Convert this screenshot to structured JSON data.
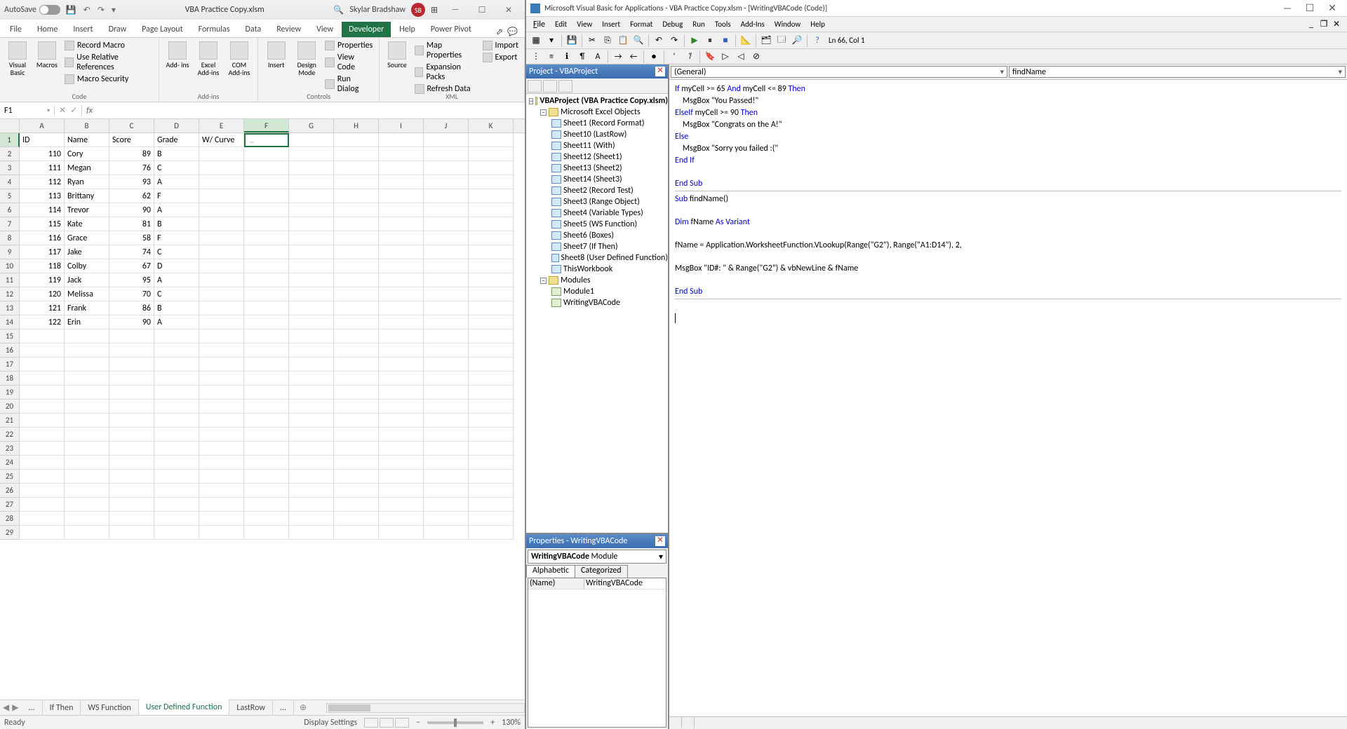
{
  "excel": {
    "autosave": "AutoSave",
    "title": "VBA Practice Copy.xlsm",
    "user_name": "Skylar Bradshaw",
    "user_initials": "SB",
    "tabs": [
      "File",
      "Home",
      "Insert",
      "Draw",
      "Page Layout",
      "Formulas",
      "Data",
      "Review",
      "View",
      "Developer",
      "Help",
      "Power Pivot"
    ],
    "active_tab": "Developer",
    "ribbon": {
      "code": {
        "label": "Code",
        "vb": "Visual\nBasic",
        "macros": "Macros",
        "record": "Record Macro",
        "relref": "Use Relative References",
        "security": "Macro Security"
      },
      "addins": {
        "label": "Add-ins",
        "addins": "Add-\nins",
        "excel_addins": "Excel\nAdd-ins",
        "com_addins": "COM\nAdd-ins"
      },
      "controls": {
        "label": "Controls",
        "insert": "Insert",
        "design": "Design\nMode",
        "props": "Properties",
        "viewcode": "View Code",
        "rundialog": "Run Dialog"
      },
      "xml": {
        "label": "XML",
        "source": "Source",
        "mapprops": "Map Properties",
        "expansion": "Expansion Packs",
        "refresh": "Refresh Data",
        "import": "Import",
        "export": "Export"
      }
    },
    "name_box": "F1",
    "columns": [
      "A",
      "B",
      "C",
      "D",
      "E",
      "F",
      "G",
      "H",
      "I",
      "J",
      "K"
    ],
    "headers": [
      "ID",
      "Name",
      "Score",
      "Grade",
      "W/ Curve"
    ],
    "rows": [
      {
        "id": "110",
        "name": "Cory",
        "score": "89",
        "grade": "B"
      },
      {
        "id": "111",
        "name": "Megan",
        "score": "76",
        "grade": "C"
      },
      {
        "id": "112",
        "name": "Ryan",
        "score": "93",
        "grade": "A"
      },
      {
        "id": "113",
        "name": "Brittany",
        "score": "62",
        "grade": "F"
      },
      {
        "id": "114",
        "name": "Trevor",
        "score": "90",
        "grade": "A"
      },
      {
        "id": "115",
        "name": "Kate",
        "score": "81",
        "grade": "B"
      },
      {
        "id": "116",
        "name": "Grace",
        "score": "58",
        "grade": "F"
      },
      {
        "id": "117",
        "name": "Jake",
        "score": "74",
        "grade": "C"
      },
      {
        "id": "118",
        "name": "Colby",
        "score": "67",
        "grade": "D"
      },
      {
        "id": "119",
        "name": "Jack",
        "score": "95",
        "grade": "A"
      },
      {
        "id": "120",
        "name": "Melissa",
        "score": "70",
        "grade": "C"
      },
      {
        "id": "121",
        "name": "Frank",
        "score": "86",
        "grade": "B"
      },
      {
        "id": "122",
        "name": "Erin",
        "score": "90",
        "grade": "A"
      }
    ],
    "sheet_tabs": [
      "...",
      "If Then",
      "WS Function",
      "User Defined Function",
      "LastRow",
      "..."
    ],
    "active_sheet": "User Defined Function",
    "status": "Ready",
    "display_settings": "Display Settings",
    "zoom": "130%"
  },
  "vba": {
    "title": "Microsoft Visual Basic for Applications - VBA Practice Copy.xlsm - [WritingVBACode (Code)]",
    "menu": [
      "File",
      "Edit",
      "View",
      "Insert",
      "Format",
      "Debug",
      "Run",
      "Tools",
      "Add-Ins",
      "Window",
      "Help"
    ],
    "position": "Ln 66, Col 1",
    "project_title": "Project - VBAProject",
    "tree": {
      "root": "VBAProject (VBA Practice Copy.xlsm)",
      "objects_label": "Microsoft Excel Objects",
      "objects": [
        "Sheet1 (Record Format)",
        "Sheet10 (LastRow)",
        "Sheet11 (With)",
        "Sheet12 (Sheet1)",
        "Sheet13 (Sheet2)",
        "Sheet14 (Sheet3)",
        "Sheet2 (Record Test)",
        "Sheet3 (Range Object)",
        "Sheet4 (Variable Types)",
        "Sheet5 (WS Function)",
        "Sheet6 (Boxes)",
        "Sheet7 (If Then)",
        "Sheet8 (User Defined Function)",
        "ThisWorkbook"
      ],
      "modules_label": "Modules",
      "modules": [
        "Module1",
        "WritingVBACode"
      ]
    },
    "props_title": "Properties - WritingVBACode",
    "props_dd_name": "WritingVBACode",
    "props_dd_type": "Module",
    "props_tabs": [
      "Alphabetic",
      "Categorized"
    ],
    "prop_name_key": "(Name)",
    "prop_name_val": "WritingVBACode",
    "dd_left": "(General)",
    "dd_right": "findName",
    "code": {
      "l1a": "If",
      "l1b": " myCell >= 65 ",
      "l1c": "And",
      "l1d": " myCell <= 89 ",
      "l1e": "Then",
      "l2": "    MsgBox \"You Passed!\"",
      "l3a": "ElseIf",
      "l3b": " myCell >= 90 ",
      "l3c": "Then",
      "l4": "    MsgBox \"Congrats on the A!\"",
      "l5": "Else",
      "l6": "    MsgBox \"Sorry you failed :(\"",
      "l7": "End If",
      "l8": "End Sub",
      "l9a": "Sub",
      "l9b": " findName()",
      "l10a": "Dim",
      "l10b": " fName ",
      "l10c": "As Variant",
      "l11": "fName = Application.WorksheetFunction.VLookup(Range(\"G2\"), Range(\"A1:D14\"), 2,",
      "l12": "MsgBox \"ID#: \" & Range(\"G2\") & vbNewLine & fName",
      "l13": "End Sub"
    }
  }
}
